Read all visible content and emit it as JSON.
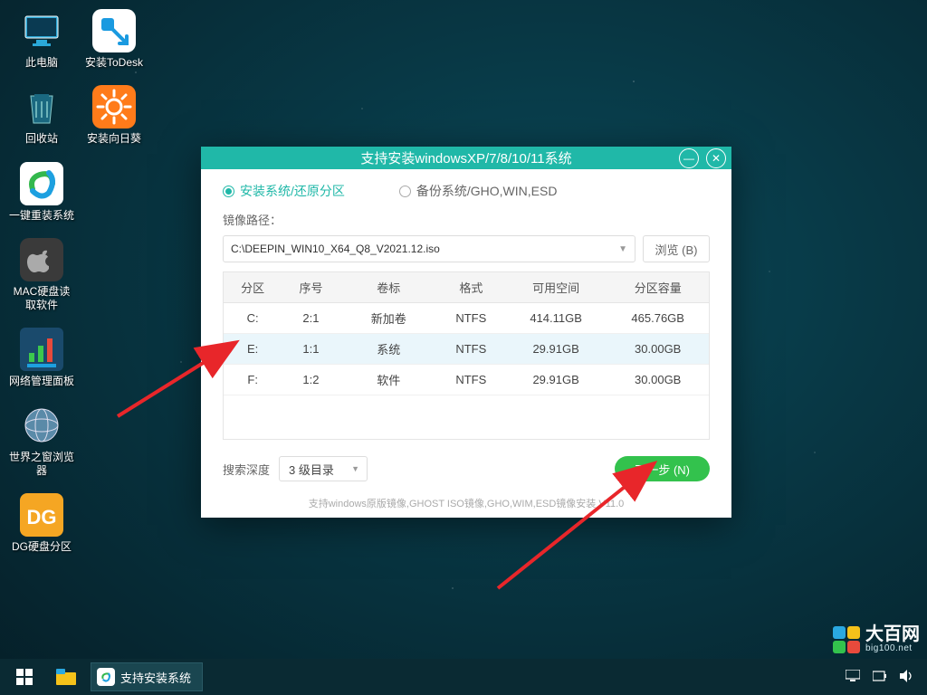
{
  "desktop": {
    "col1": [
      {
        "label": "此电脑",
        "bg": "transparent"
      },
      {
        "label": "回收站",
        "bg": "transparent"
      },
      {
        "label": "一键重装系统",
        "bg": "#fff"
      },
      {
        "label": "MAC硬盘读取软件",
        "bg": "#3a3a3a"
      },
      {
        "label": "网络管理面板",
        "bg": "#1a6b8c"
      },
      {
        "label": "世界之窗浏览器",
        "bg": "transparent"
      },
      {
        "label": "DG硬盘分区",
        "bg": "#f5a623"
      }
    ],
    "col2": [
      {
        "label": "安装ToDesk",
        "bg": "#fff"
      },
      {
        "label": "安装向日葵",
        "bg": "#ff7b1a"
      }
    ]
  },
  "window": {
    "title": "支持安装windowsXP/7/8/10/11系统",
    "tab_install": "安装系统/还原分区",
    "tab_backup": "备份系统/GHO,WIN,ESD",
    "image_path_label": "镜像路径：",
    "image_path_value": "C:\\DEEPIN_WIN10_X64_Q8_V2021.12.iso",
    "browse_label": "浏览 (B)",
    "table_headers": [
      "分区",
      "序号",
      "卷标",
      "格式",
      "可用空间",
      "分区容量"
    ],
    "table_rows": [
      {
        "drive": "C:",
        "idx": "2:1",
        "label": "新加卷",
        "fs": "NTFS",
        "free": "414.11GB",
        "total": "465.76GB",
        "sel": false
      },
      {
        "drive": "E:",
        "idx": "1:1",
        "label": "系统",
        "fs": "NTFS",
        "free": "29.91GB",
        "total": "30.00GB",
        "sel": true
      },
      {
        "drive": "F:",
        "idx": "1:2",
        "label": "软件",
        "fs": "NTFS",
        "free": "29.91GB",
        "total": "30.00GB",
        "sel": false
      }
    ],
    "search_depth_label": "搜索深度",
    "search_depth_value": "3 级目录",
    "next_label": "下一步 (N)",
    "footer": "支持windows原版镜像,GHOST ISO镜像,GHO,WIM,ESD镜像安装 V11.0"
  },
  "taskbar": {
    "task_label": "支持安装系统"
  },
  "watermark": {
    "name": "大百网",
    "sub": "big100.net"
  }
}
